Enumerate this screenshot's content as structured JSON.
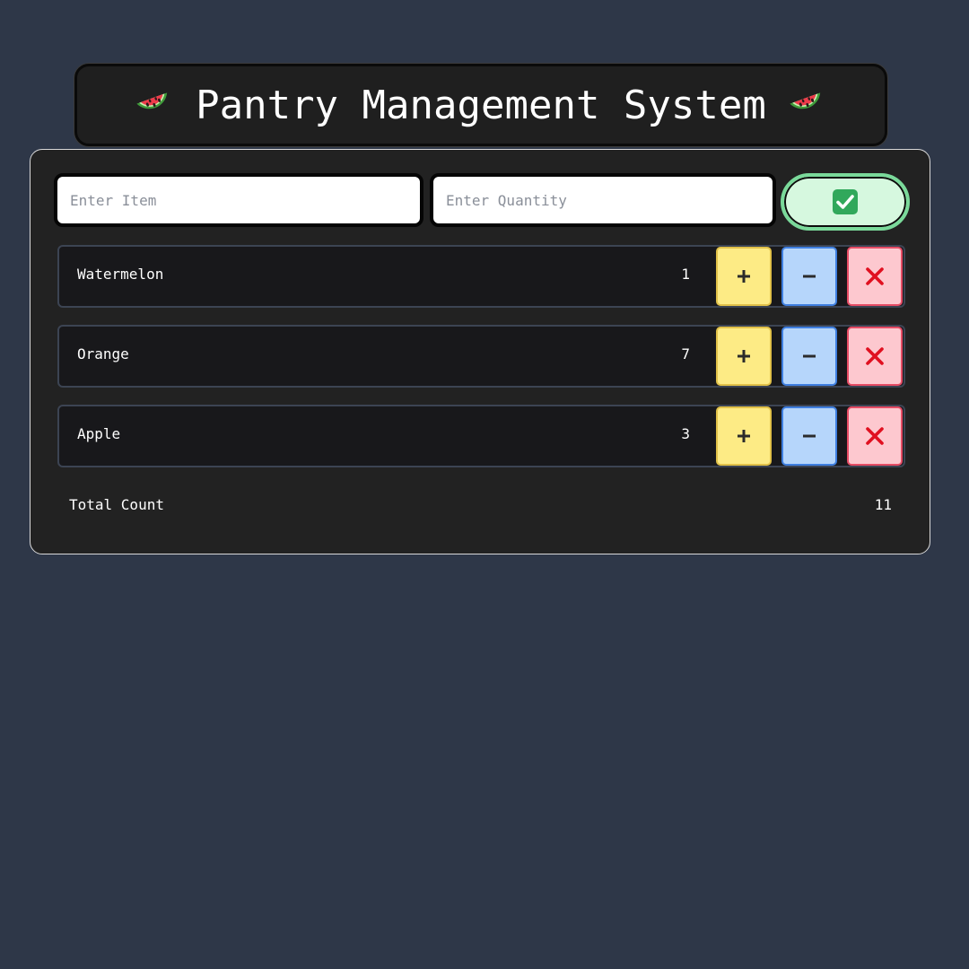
{
  "header": {
    "title": "Pantry Management System",
    "left_icon": "watermelon-icon",
    "right_icon": "watermelon-icon"
  },
  "form": {
    "item_placeholder": "Enter Item",
    "item_value": "",
    "quantity_placeholder": "Enter Quantity",
    "quantity_value": "",
    "submit_icon": "check-mark-icon"
  },
  "items": [
    {
      "name": "Watermelon",
      "quantity": "1"
    },
    {
      "name": "Orange",
      "quantity": "7"
    },
    {
      "name": "Apple",
      "quantity": "3"
    }
  ],
  "row_actions": {
    "increment_icon": "plus-icon",
    "decrement_icon": "minus-icon",
    "delete_icon": "cross-icon"
  },
  "total": {
    "label": "Total Count",
    "value": "11"
  },
  "colors": {
    "background": "#2e3748",
    "panel": "#222222",
    "increment": "#fdeb85",
    "decrement": "#b6d6fb",
    "delete": "#fdc8cf",
    "submit": "#d6f8df"
  }
}
